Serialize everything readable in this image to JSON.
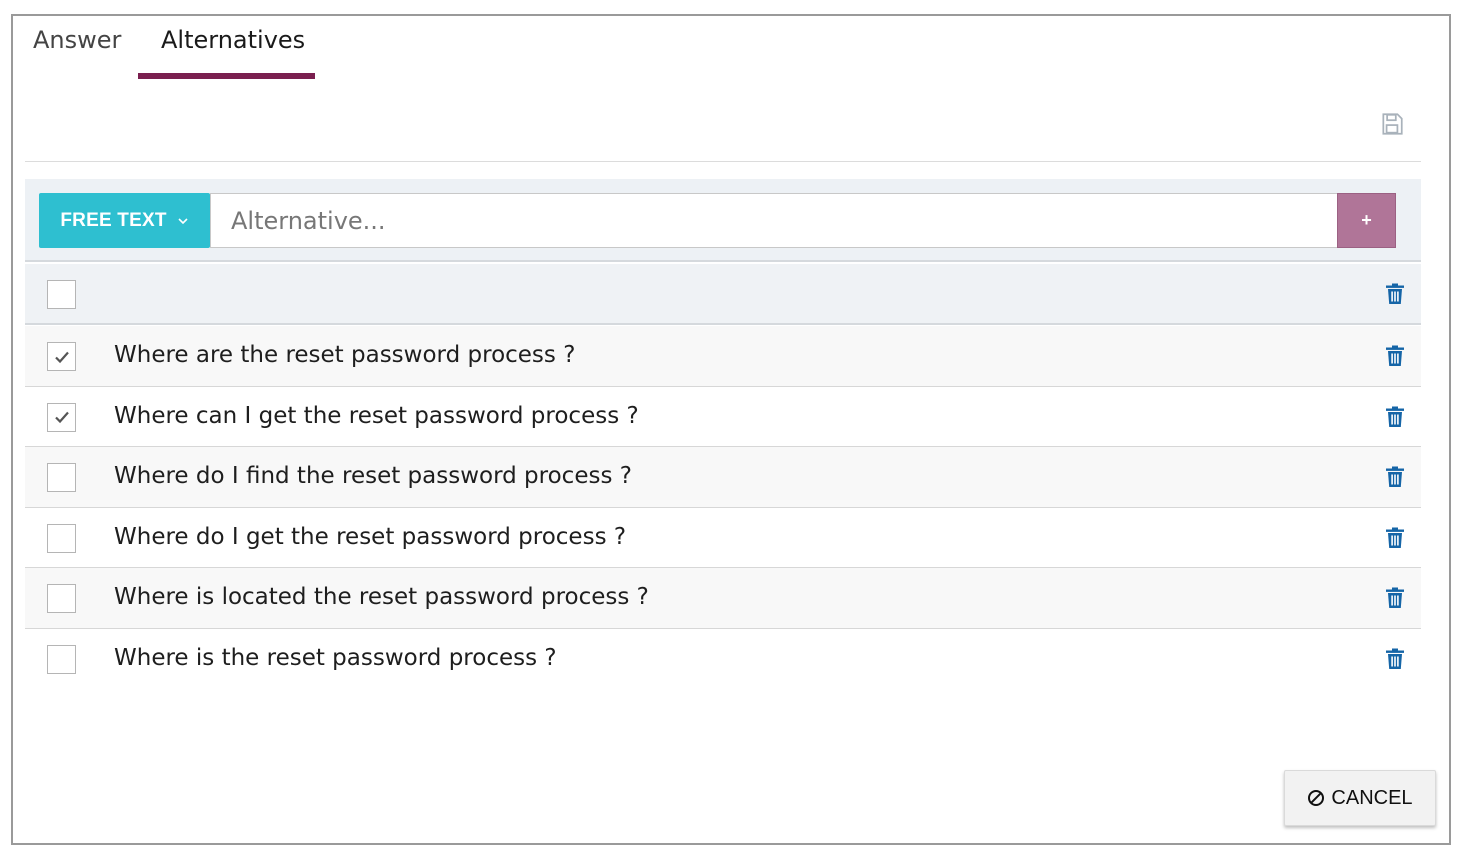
{
  "tabs": [
    {
      "label": "Answer",
      "active": false
    },
    {
      "label": "Alternatives",
      "active": true
    }
  ],
  "toolbar": {
    "save_icon": "save-icon"
  },
  "input_bar": {
    "type_label": "FREE TEXT",
    "placeholder": "Alternative...",
    "value": "",
    "add_label": "+"
  },
  "alternatives": [
    {
      "text": "Where are the reset password process ?",
      "checked": true
    },
    {
      "text": "Where can I get the reset password process ?",
      "checked": true
    },
    {
      "text": "Where do I find the reset password process ?",
      "checked": false
    },
    {
      "text": "Where do I get the reset password process ?",
      "checked": false
    },
    {
      "text": "Where is located the reset password process ?",
      "checked": false
    },
    {
      "text": "Where is the reset password process ?",
      "checked": false
    }
  ],
  "footer": {
    "cancel_label": "CANCEL"
  },
  "colors": {
    "tab_accent": "#7a1f4f",
    "type_button": "#2ebfd0",
    "add_button": "#b07598",
    "trash_icon": "#1565a7"
  }
}
